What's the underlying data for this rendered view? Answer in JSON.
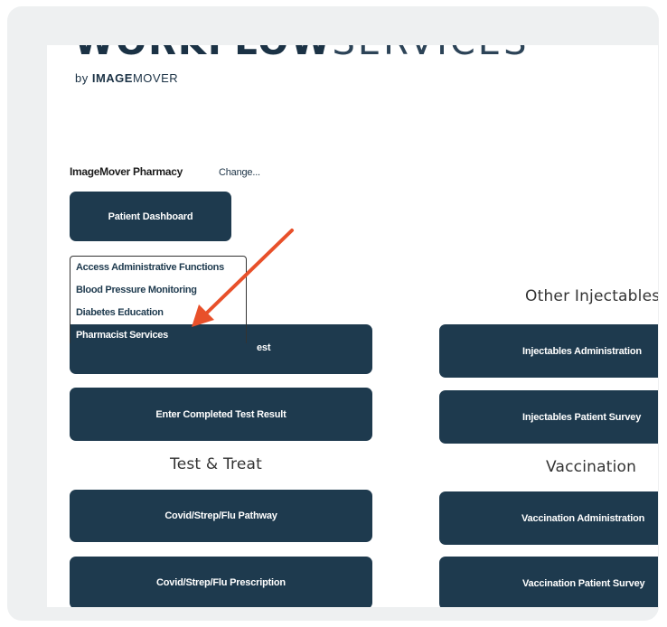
{
  "brand": {
    "logo_bold": "WORKFLOW",
    "logo_light": "SERVICES",
    "by_prefix": "by ",
    "by_bold": "IMAGE",
    "by_light": "MOVER"
  },
  "pharmacy": {
    "name": "ImageMover Pharmacy",
    "change_label": "Change..."
  },
  "buttons": {
    "patient_dashboard": "Patient Dashboard",
    "hidden_request_suffix": "est",
    "enter_completed_test_result": "Enter Completed Test Result",
    "covid_pathway": "Covid/Strep/Flu Pathway",
    "covid_prescription": "Covid/Strep/Flu Prescription",
    "injectables_administration": "Injectables Administration",
    "injectables_patient_survey": "Injectables Patient Survey",
    "vaccination_administration": "Vaccination Administration",
    "vaccination_patient_survey": "Vaccination Patient Survey"
  },
  "dropdown": {
    "items": [
      "Access Administrative Functions",
      "Blood Pressure Monitoring",
      "Diabetes Education",
      "Pharmacist Services"
    ],
    "selected": "Pharmacist Services"
  },
  "sections": {
    "other_injectables": "Other Injectables",
    "test_and_treat": "Test & Treat",
    "vaccination": "Vaccination"
  },
  "colors": {
    "button_bg": "#1e3a4e",
    "annotation_arrow": "#e8502a",
    "frame_bg": "#eef0f1"
  }
}
